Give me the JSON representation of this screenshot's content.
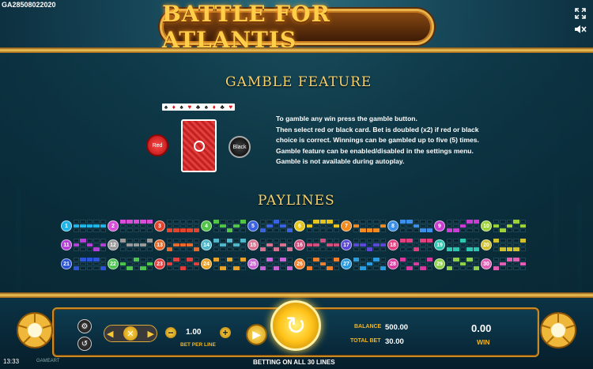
{
  "header": {
    "game_id": "GA28508022020",
    "logo_text": "BATTLE FOR ATLANTIS"
  },
  "gamble": {
    "title": "GAMBLE FEATURE",
    "red_label": "Red",
    "black_label": "Black",
    "instructions": [
      "To gamble any win press the gamble button.",
      "Then select red or black card. Bet is doubled (x2) if red or black",
      "choice is correct. Winnings can be gambled up to five (5) times.",
      "Gamble feature can be enabled/disabled in the settings menu.",
      "Gamble is not available during autoplay."
    ]
  },
  "paylines": {
    "title": "PAYLINES",
    "colors": [
      "#1fb5e9",
      "#d64fd6",
      "#e0442c",
      "#52c447",
      "#3a62e0",
      "#e7c31f",
      "#f28a1f",
      "#3c8fe8",
      "#c93dd0",
      "#9dd13a",
      "#b43fd6",
      "#999999",
      "#e86a2a",
      "#4fb7c9",
      "#d9728f",
      "#d14f7c",
      "#5b48d6",
      "#e0407f",
      "#2fc6b0",
      "#cfc12f",
      "#2b55d6",
      "#4ec24e",
      "#e33e3e",
      "#e9a22a",
      "#c864d4",
      "#f07e2a",
      "#2b9be0",
      "#d93aa0",
      "#8fd04a",
      "#e05fb5"
    ],
    "patterns": [
      [
        1,
        1,
        1,
        1,
        1
      ],
      [
        0,
        0,
        0,
        0,
        0
      ],
      [
        2,
        2,
        2,
        2,
        2
      ],
      [
        0,
        1,
        2,
        1,
        0
      ],
      [
        2,
        1,
        0,
        1,
        2
      ],
      [
        1,
        0,
        0,
        0,
        1
      ],
      [
        1,
        2,
        2,
        2,
        1
      ],
      [
        0,
        0,
        1,
        2,
        2
      ],
      [
        2,
        2,
        1,
        0,
        0
      ],
      [
        1,
        2,
        1,
        0,
        1
      ],
      [
        1,
        0,
        1,
        2,
        1
      ],
      [
        0,
        1,
        1,
        1,
        0
      ],
      [
        2,
        1,
        1,
        1,
        2
      ],
      [
        0,
        1,
        0,
        1,
        0
      ],
      [
        2,
        1,
        2,
        1,
        2
      ],
      [
        1,
        1,
        0,
        1,
        1
      ],
      [
        1,
        1,
        2,
        1,
        1
      ],
      [
        0,
        0,
        2,
        0,
        0
      ],
      [
        2,
        2,
        0,
        2,
        2
      ],
      [
        0,
        2,
        2,
        2,
        0
      ],
      [
        2,
        0,
        0,
        0,
        2
      ],
      [
        1,
        2,
        0,
        2,
        1
      ],
      [
        1,
        0,
        2,
        0,
        1
      ],
      [
        0,
        2,
        0,
        2,
        0
      ],
      [
        2,
        0,
        2,
        0,
        2
      ],
      [
        2,
        0,
        1,
        2,
        0
      ],
      [
        0,
        2,
        1,
        0,
        2
      ],
      [
        0,
        2,
        1,
        2,
        0
      ],
      [
        2,
        0,
        1,
        0,
        2
      ],
      [
        2,
        1,
        0,
        0,
        1
      ]
    ]
  },
  "console": {
    "bet_value": "1.00",
    "bet_label": "BET PER LINE",
    "balance_label": "BALANCE",
    "balance_value": "500.00",
    "totalbet_label": "TOTAL BET",
    "totalbet_value": "30.00",
    "win_value": "0.00",
    "win_label": "WIN",
    "time": "13:33",
    "provider": "GAMEART",
    "lines_text": "BETTING ON ALL 30 LINES"
  }
}
